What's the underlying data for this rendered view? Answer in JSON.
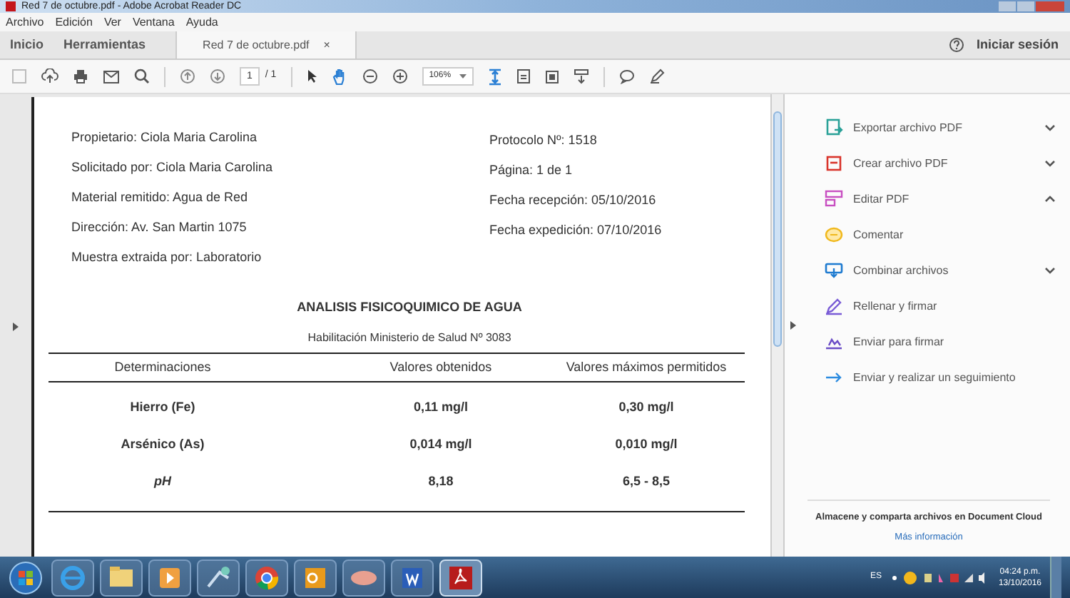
{
  "window": {
    "title": "Red 7 de octubre.pdf - Adobe Acrobat Reader DC"
  },
  "menu": [
    "Archivo",
    "Edición",
    "Ver",
    "Ventana",
    "Ayuda"
  ],
  "tabs": [
    {
      "label": "Inicio",
      "selected": false
    },
    {
      "label": "Herramientas",
      "selected": false
    },
    {
      "label": "Red 7 de octubre.pdf",
      "selected": true,
      "close": "×"
    }
  ],
  "sign_in": "Iniciar sesión",
  "toolbar": {
    "page": "1",
    "page_count": "/ 1",
    "zoom": "106%"
  },
  "document": {
    "left_fields": [
      "Propietario: Ciola Maria Carolina",
      "Solicitado por: Ciola Maria Carolina",
      "Material remitido: Agua de Red",
      "Dirección: Av. San Martin 1075",
      "Muestra extraida por: Laboratorio"
    ],
    "right_fields": [
      "Protocolo Nº: 1518",
      "Página: 1 de 1",
      "Fecha recepción: 05/10/2016",
      "Fecha expedición: 07/10/2016"
    ],
    "title": "ANALISIS FISICOQUIMICO  DE AGUA",
    "subtitle": "Habilitación Ministerio de Salud Nº 3083",
    "table": {
      "columns": [
        "Determinaciones",
        "Valores obtenidos",
        "Valores máximos permitidos"
      ],
      "rows": [
        {
          "cells": [
            "Hierro (Fe)",
            "0,11 mg/l",
            "0,30 mg/l"
          ],
          "italic": false
        },
        {
          "cells": [
            "Arsénico (As)",
            "0,014 mg/l",
            "0,010 mg/l"
          ],
          "italic": false
        },
        {
          "cells": [
            "pH",
            "8,18",
            "6,5 - 8,5"
          ],
          "italic": true
        }
      ]
    }
  },
  "tools": [
    {
      "label": "Exportar archivo PDF",
      "kind": "expandable",
      "expanded": false
    },
    {
      "label": "Crear archivo PDF",
      "kind": "expandable",
      "expanded": false
    },
    {
      "label": "Editar PDF",
      "kind": "expandable",
      "expanded": true
    },
    {
      "label": "Comentar",
      "kind": "plain"
    },
    {
      "label": "Combinar archivos",
      "kind": "expandable",
      "expanded": false
    },
    {
      "label": "Rellenar y firmar",
      "kind": "plain"
    },
    {
      "label": "Enviar para firmar",
      "kind": "plain"
    },
    {
      "label": "Enviar y realizar un seguimiento",
      "kind": "plain"
    }
  ],
  "cloud": {
    "text": "Almacene y comparta archivos en Document Cloud",
    "link": "Más información"
  },
  "taskbar": {
    "language": "ES",
    "time": "04:24 p.m.",
    "date": "13/10/2016"
  }
}
